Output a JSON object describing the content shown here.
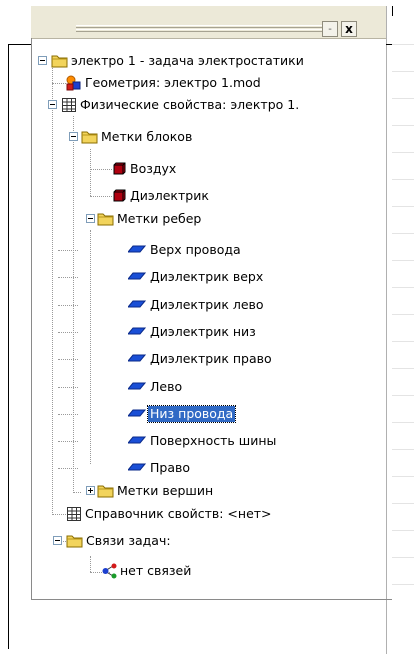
{
  "window": {
    "minimize_glyph": "-",
    "close_glyph": "x"
  },
  "tree": {
    "root": {
      "label": "электро 1 - задача электростатики",
      "icon": "folder-icon"
    },
    "geometry": {
      "label": "Геометрия: электро 1.mod",
      "icon": "geometry-shapes-icon"
    },
    "physics": {
      "label": "Физические свойства: электро 1.",
      "icon": "table-grid-icon"
    },
    "block_labels": {
      "label": "Метки блоков",
      "icon": "folder-icon"
    },
    "blocks": [
      {
        "label": "Воздух",
        "icon": "block-cube-icon"
      },
      {
        "label": "Диэлектрик",
        "icon": "block-cube-icon"
      }
    ],
    "edge_labels": {
      "label": "Метки ребер",
      "icon": "folder-icon"
    },
    "edges": [
      {
        "label": "Верх провода",
        "icon": "edge-parallelogram-icon"
      },
      {
        "label": "Диэлектрик верх",
        "icon": "edge-parallelogram-icon"
      },
      {
        "label": "Диэлектрик лево",
        "icon": "edge-parallelogram-icon"
      },
      {
        "label": "Диэлектрик низ",
        "icon": "edge-parallelogram-icon"
      },
      {
        "label": "Диэлектрик право",
        "icon": "edge-parallelogram-icon"
      },
      {
        "label": "Лево",
        "icon": "edge-parallelogram-icon"
      },
      {
        "label": "Низ провода",
        "icon": "edge-parallelogram-icon",
        "selected": true
      },
      {
        "label": "Поверхность шины",
        "icon": "edge-parallelogram-icon"
      },
      {
        "label": "Право",
        "icon": "edge-parallelogram-icon"
      }
    ],
    "vertex_labels": {
      "label": "Метки вершин",
      "icon": "folder-icon"
    },
    "property_reference": {
      "label": "Справочник свойств: <нет>",
      "icon": "table-grid-icon"
    },
    "task_links": {
      "label": "Связи задач:",
      "icon": "folder-icon"
    },
    "no_links": {
      "label": "нет связей",
      "icon": "link-nodes-icon"
    }
  },
  "colors": {
    "selection": "#316ac5",
    "edge_icon": "#1a4fd6",
    "block_icon": "#b00010",
    "folder": "#f2d45c"
  }
}
